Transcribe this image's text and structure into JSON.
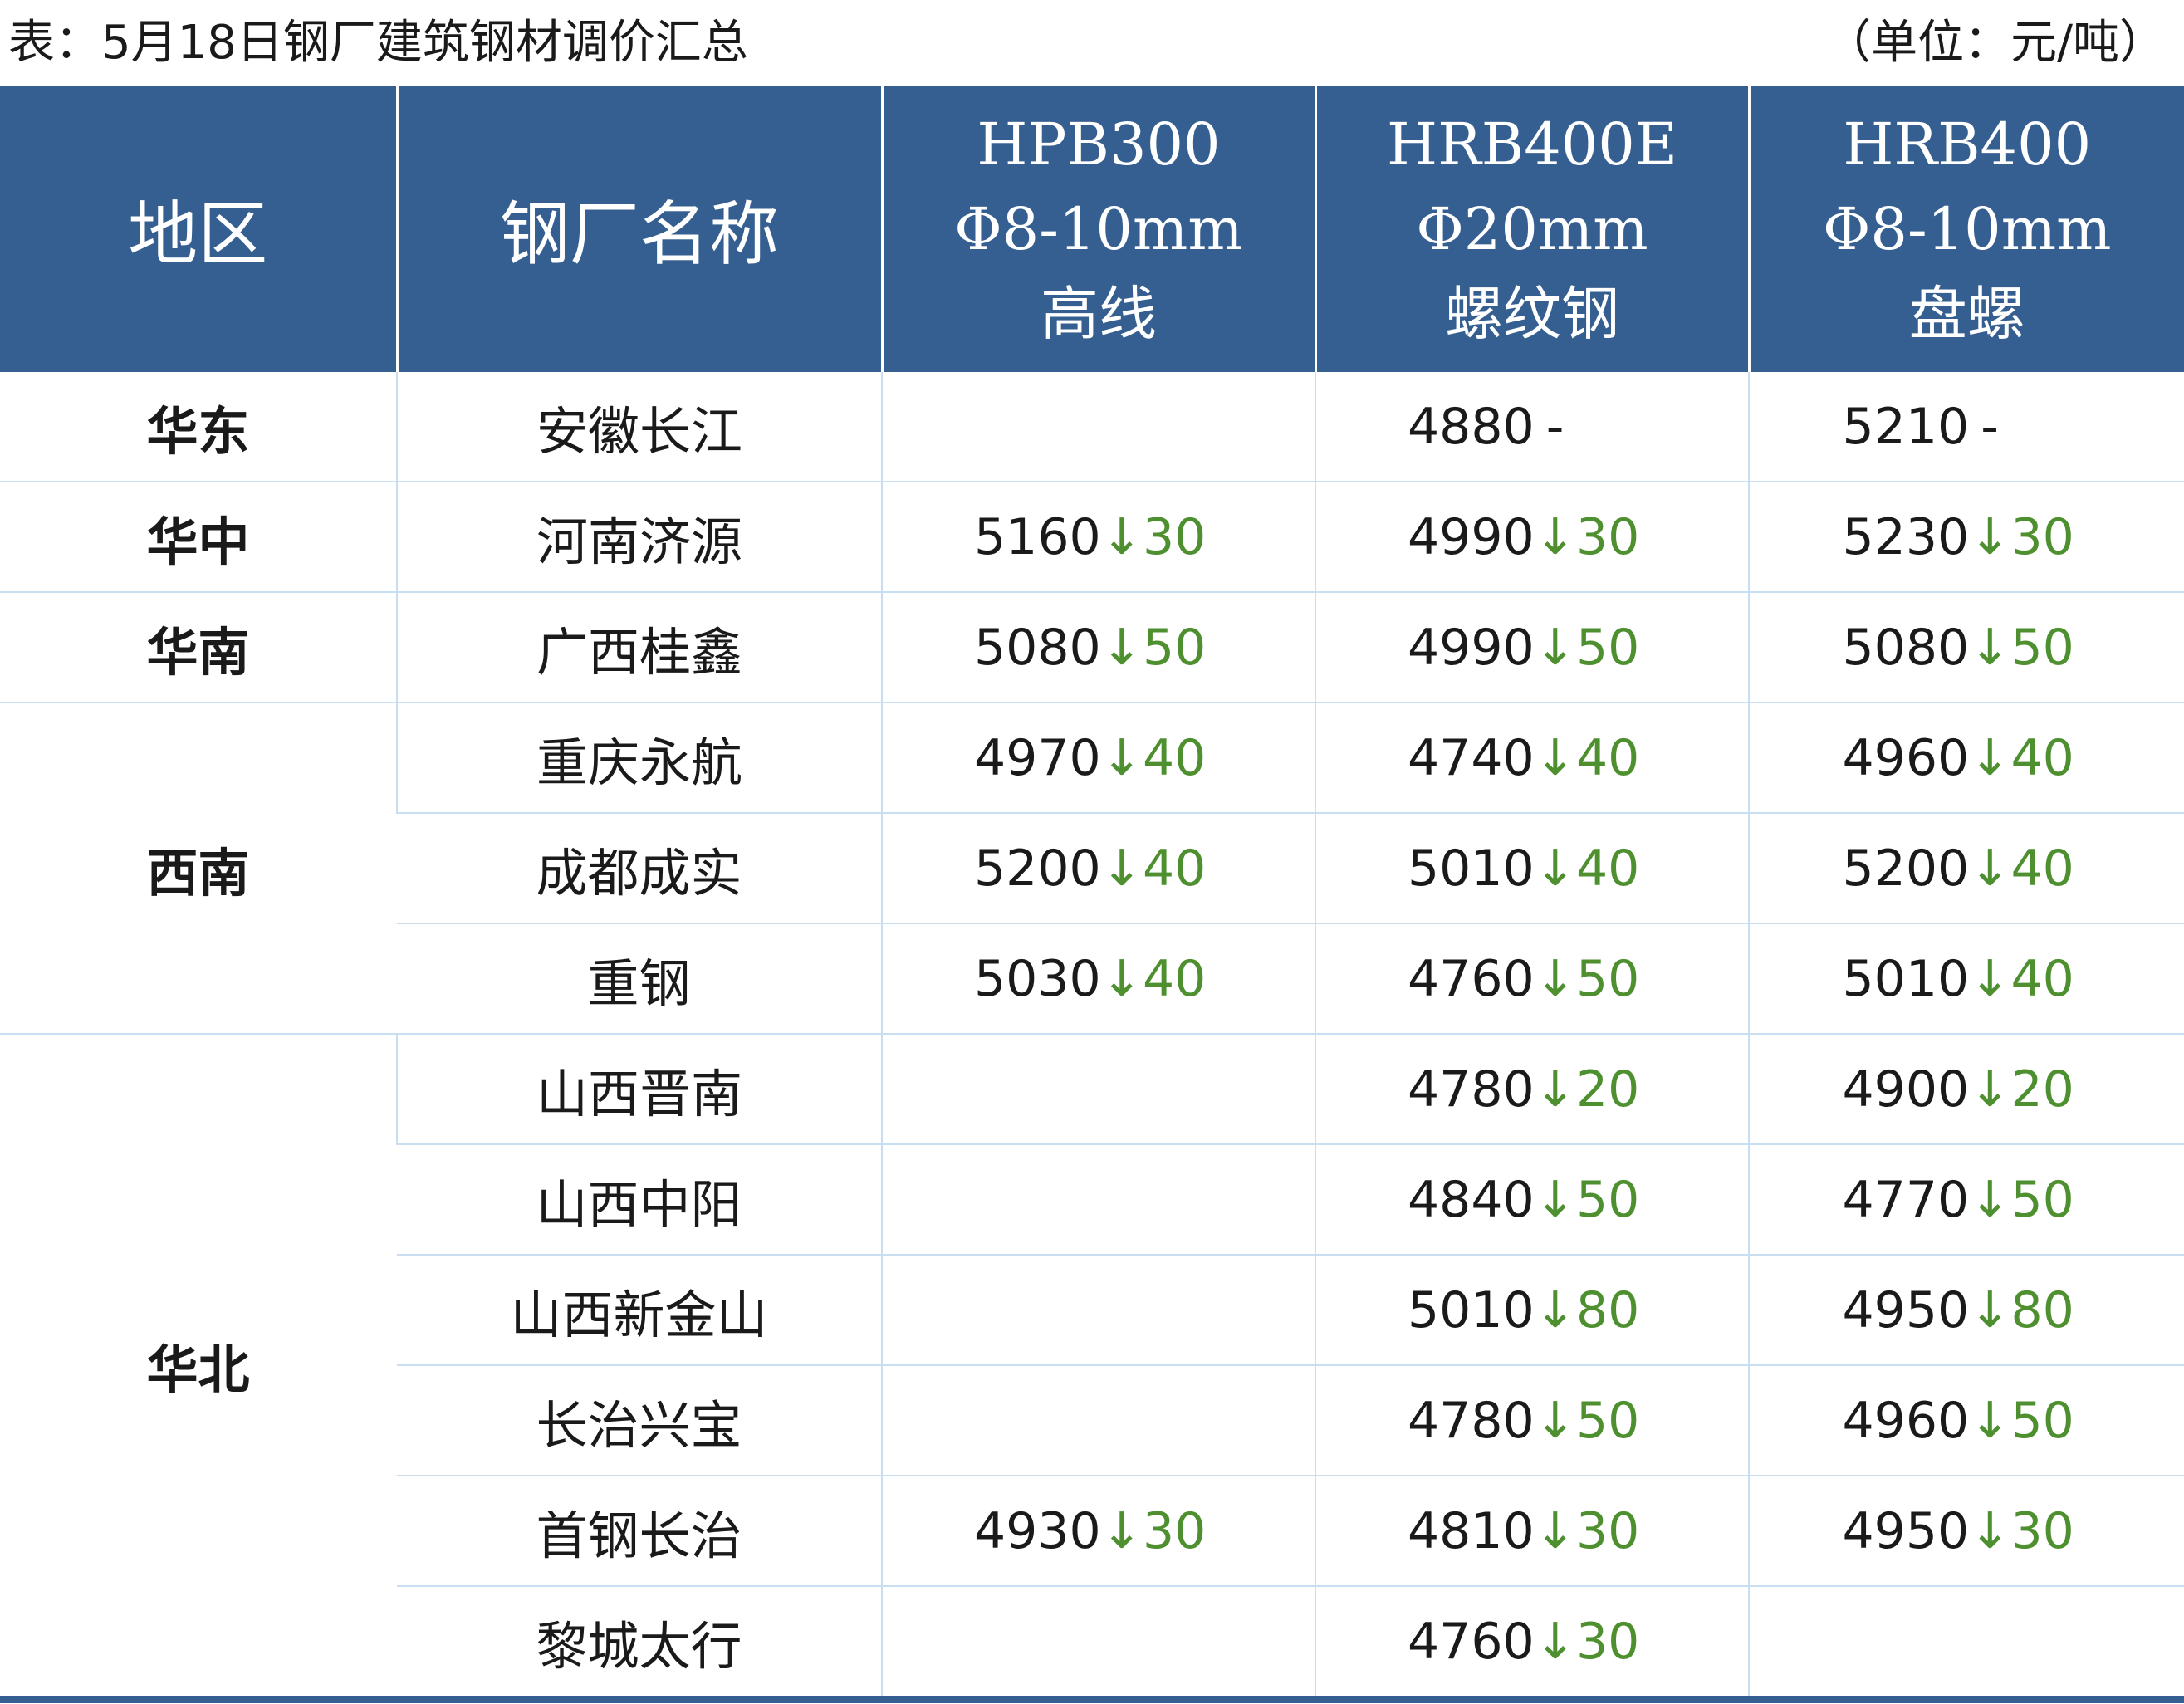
{
  "caption": {
    "title": "表：5月18日钢厂建筑钢材调价汇总",
    "unit": "（单位：元/吨）"
  },
  "colors": {
    "header_bg": "#365f91",
    "change_green": "#4e8f2f",
    "row_line": "#c9dff1"
  },
  "headers": {
    "region": "地区",
    "mill": "钢厂名称",
    "col1": {
      "grade": "HPB300",
      "spec": "Φ8-10mm",
      "type": "高线"
    },
    "col2": {
      "grade": "HRB400E",
      "spec": "Φ20mm",
      "type": "螺纹钢"
    },
    "col3": {
      "grade": "HRB400",
      "spec": "Φ8-10mm",
      "type": "盘螺"
    }
  },
  "regions": [
    "华东",
    "华中",
    "华南",
    "西南",
    "华北"
  ],
  "rows": [
    {
      "mill": "安徽长江",
      "c1": null,
      "c2": {
        "v": "4880",
        "a": "",
        "c": "-"
      },
      "c3": {
        "v": "5210",
        "a": "",
        "c": "-"
      }
    },
    {
      "mill": "河南济源",
      "c1": {
        "v": "5160",
        "a": "↓",
        "c": "30"
      },
      "c2": {
        "v": "4990",
        "a": "↓",
        "c": "30"
      },
      "c3": {
        "v": "5230",
        "a": "↓",
        "c": "30"
      }
    },
    {
      "mill": "广西桂鑫",
      "c1": {
        "v": "5080",
        "a": "↓",
        "c": "50"
      },
      "c2": {
        "v": "4990",
        "a": "↓",
        "c": "50"
      },
      "c3": {
        "v": "5080",
        "a": "↓",
        "c": "50"
      }
    },
    {
      "mill": "重庆永航",
      "c1": {
        "v": "4970",
        "a": "↓",
        "c": "40"
      },
      "c2": {
        "v": "4740",
        "a": "↓",
        "c": "40"
      },
      "c3": {
        "v": "4960",
        "a": "↓",
        "c": "40"
      }
    },
    {
      "mill": "成都成实",
      "c1": {
        "v": "5200",
        "a": "↓",
        "c": "40"
      },
      "c2": {
        "v": "5010",
        "a": "↓",
        "c": "40"
      },
      "c3": {
        "v": "5200",
        "a": "↓",
        "c": "40"
      }
    },
    {
      "mill": "重钢",
      "c1": {
        "v": "5030",
        "a": "↓",
        "c": "40"
      },
      "c2": {
        "v": "4760",
        "a": "↓",
        "c": "50"
      },
      "c3": {
        "v": "5010",
        "a": "↓",
        "c": "40"
      }
    },
    {
      "mill": "山西晋南",
      "c1": null,
      "c2": {
        "v": "4780",
        "a": "↓",
        "c": "20"
      },
      "c3": {
        "v": "4900",
        "a": "↓",
        "c": "20"
      }
    },
    {
      "mill": "山西中阳",
      "c1": null,
      "c2": {
        "v": "4840",
        "a": "↓",
        "c": "50"
      },
      "c3": {
        "v": "4770",
        "a": "↓",
        "c": "50"
      }
    },
    {
      "mill": "山西新金山",
      "c1": null,
      "c2": {
        "v": "5010",
        "a": "↓",
        "c": "80"
      },
      "c3": {
        "v": "4950",
        "a": "↓",
        "c": "80"
      }
    },
    {
      "mill": "长治兴宝",
      "c1": null,
      "c2": {
        "v": "4780",
        "a": "↓",
        "c": "50"
      },
      "c3": {
        "v": "4960",
        "a": "↓",
        "c": "50"
      }
    },
    {
      "mill": "首钢长治",
      "c1": {
        "v": "4930",
        "a": "↓",
        "c": "30"
      },
      "c2": {
        "v": "4810",
        "a": "↓",
        "c": "30"
      },
      "c3": {
        "v": "4950",
        "a": "↓",
        "c": "30"
      }
    },
    {
      "mill": "黎城太行",
      "c1": null,
      "c2": {
        "v": "4760",
        "a": "↓",
        "c": "30"
      },
      "c3": null
    }
  ]
}
